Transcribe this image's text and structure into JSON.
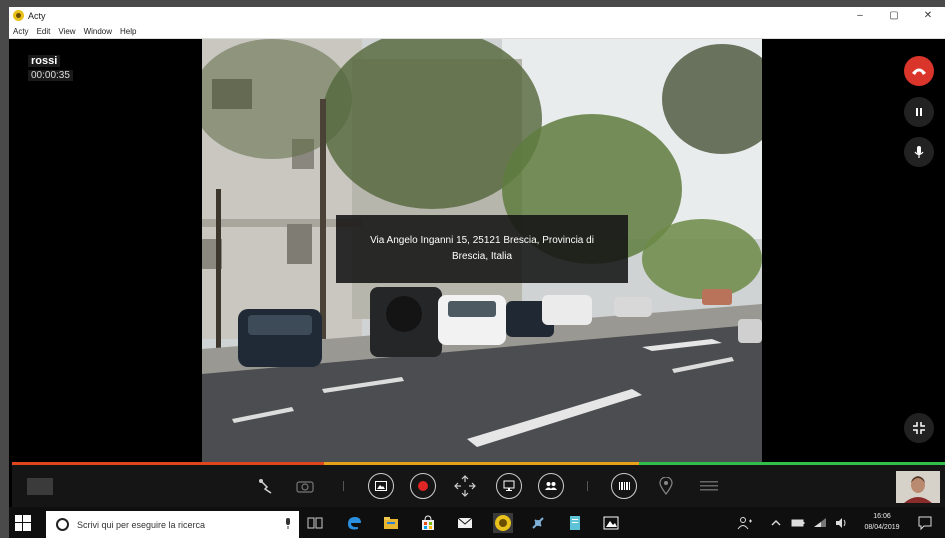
{
  "window": {
    "title": "Acty",
    "controls": {
      "minimize": "–",
      "maximize": "▢",
      "close": "✕"
    }
  },
  "menu": [
    "Acty",
    "Edit",
    "View",
    "Window",
    "Help"
  ],
  "call": {
    "caller_name": "rossi",
    "elapsed": "00:00:35",
    "location_text": "Via Angelo Inganni 15, 25121 Brescia, Provincia di Brescia, Italia"
  },
  "progress_colors": {
    "segment_1": "#e0461e",
    "segment_2": "#e8a21a",
    "segment_3": "#2fbf4a"
  },
  "accent": {
    "hangup": "#d9352a",
    "record": "#e02525"
  },
  "icons": {
    "hangup": "phone-hangup-icon",
    "pause": "pause-icon",
    "mic": "microphone-icon",
    "fullscreen": "collapse-icon",
    "pointer": "laser-pointer-icon",
    "camera": "camera-switch-icon",
    "photo": "photo-icon",
    "record": "record-icon",
    "stabilize": "stabilize-icon",
    "screen_share": "screen-share-icon",
    "participants": "participants-icon",
    "barcode": "barcode-icon",
    "location": "location-pin-icon",
    "list": "list-icon"
  },
  "taskbar": {
    "search_placeholder": "Scrivi qui per eseguire la ricerca",
    "time": "16:06",
    "date": "08/04/2019"
  }
}
